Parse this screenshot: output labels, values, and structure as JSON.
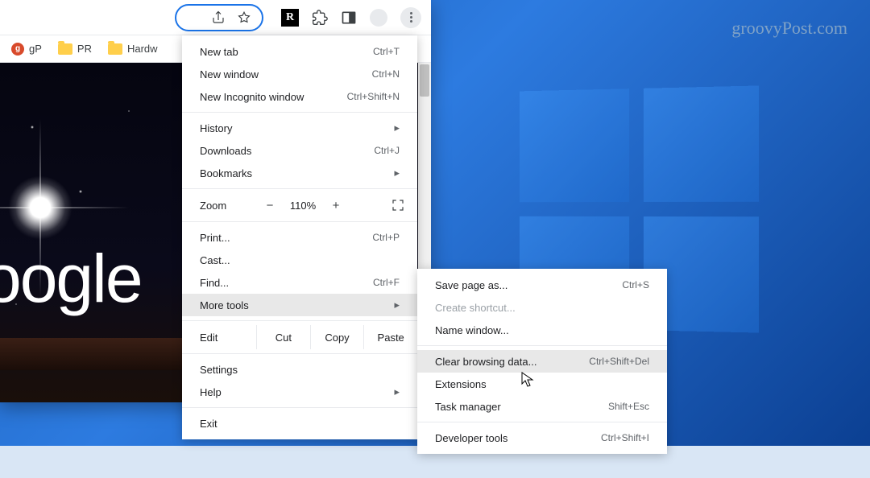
{
  "watermark": "groovyPost.com",
  "bookmarks": [
    {
      "kind": "site",
      "label": "gP"
    },
    {
      "kind": "folder",
      "label": "PR"
    },
    {
      "kind": "folder",
      "label": "Hardw"
    }
  ],
  "content_logo_text": "oogle",
  "menu": {
    "new_tab": {
      "label": "New tab",
      "shortcut": "Ctrl+T"
    },
    "new_window": {
      "label": "New window",
      "shortcut": "Ctrl+N"
    },
    "incognito": {
      "label": "New Incognito window",
      "shortcut": "Ctrl+Shift+N"
    },
    "history": {
      "label": "History"
    },
    "downloads": {
      "label": "Downloads",
      "shortcut": "Ctrl+J"
    },
    "bookmarks": {
      "label": "Bookmarks"
    },
    "zoom": {
      "label": "Zoom",
      "minus": "−",
      "value": "110%",
      "plus": "+"
    },
    "print": {
      "label": "Print...",
      "shortcut": "Ctrl+P"
    },
    "cast": {
      "label": "Cast..."
    },
    "find": {
      "label": "Find...",
      "shortcut": "Ctrl+F"
    },
    "more_tools": {
      "label": "More tools"
    },
    "edit": {
      "label": "Edit",
      "cut": "Cut",
      "copy": "Copy",
      "paste": "Paste"
    },
    "settings": {
      "label": "Settings"
    },
    "help": {
      "label": "Help"
    },
    "exit": {
      "label": "Exit"
    }
  },
  "submenu": {
    "save_page": {
      "label": "Save page as...",
      "shortcut": "Ctrl+S"
    },
    "create_shortcut": {
      "label": "Create shortcut..."
    },
    "name_window": {
      "label": "Name window..."
    },
    "clear_data": {
      "label": "Clear browsing data...",
      "shortcut": "Ctrl+Shift+Del"
    },
    "extensions": {
      "label": "Extensions"
    },
    "task_manager": {
      "label": "Task manager",
      "shortcut": "Shift+Esc"
    },
    "dev_tools": {
      "label": "Developer tools",
      "shortcut": "Ctrl+Shift+I"
    }
  }
}
